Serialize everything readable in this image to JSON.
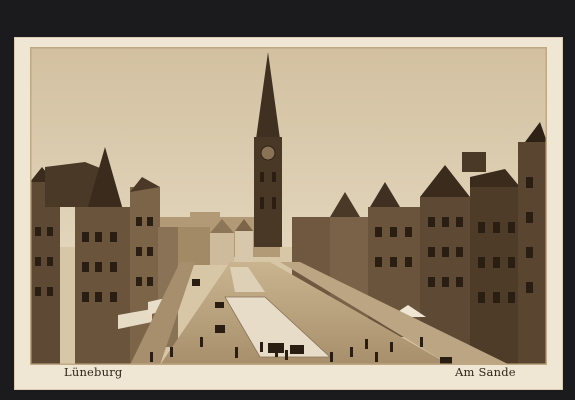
{
  "postcard": {
    "caption_left": "Lüneburg",
    "caption_right": "Am Sande"
  },
  "palette": {
    "paper": "#efe6d3",
    "sky": "#d6c6a8",
    "sepia_dark": "#3a2b1c",
    "sepia_mid": "#7a6248",
    "sepia_light": "#bfa985"
  }
}
